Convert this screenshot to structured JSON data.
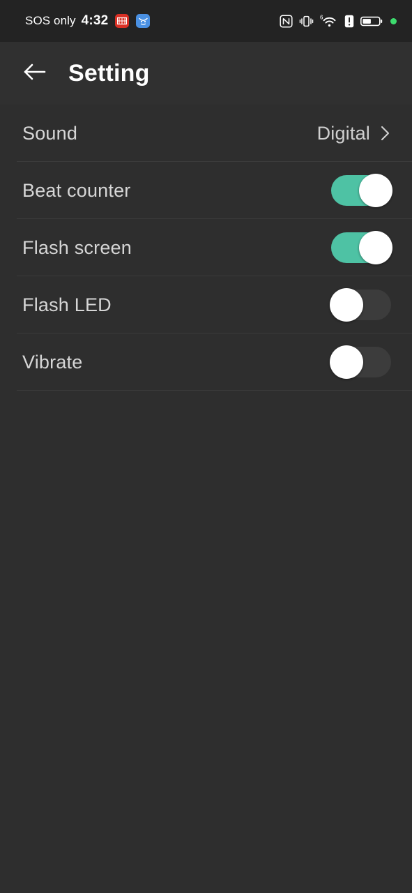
{
  "status_bar": {
    "carrier": "SOS only",
    "clock": "4:32",
    "app_badges": [
      {
        "name": "red-app-icon",
        "color": "#d93025"
      },
      {
        "name": "blue-app-icon",
        "color": "#4a90e2"
      }
    ],
    "icons": [
      "nfc-icon",
      "vibrate-icon",
      "wifi-6-icon",
      "alert-badge-icon",
      "battery-icon",
      "green-privacy-dot"
    ],
    "battery_level_percent": 50,
    "wifi_generation": "6"
  },
  "header": {
    "back_label": "back-arrow",
    "title": "Setting"
  },
  "colors": {
    "background": "#2e2e2e",
    "status_bar_bg": "#232323",
    "header_bg": "#303030",
    "divider": "#3b3b3b",
    "toggle_on": "#4ec2a4",
    "toggle_off": "#3c3c3c",
    "knob": "#ffffff",
    "label_text": "#d6d6d6",
    "title_text": "#ffffff",
    "accent_dot": "#3ddc6e"
  },
  "settings": {
    "rows": [
      {
        "label": "Sound",
        "type": "navigation",
        "value": "Digital",
        "chevron": true
      },
      {
        "label": "Beat counter",
        "type": "toggle",
        "state": "on"
      },
      {
        "label": "Flash screen",
        "type": "toggle",
        "state": "on"
      },
      {
        "label": "Flash LED",
        "type": "toggle",
        "state": "off"
      },
      {
        "label": "Vibrate",
        "type": "toggle",
        "state": "off"
      }
    ]
  }
}
